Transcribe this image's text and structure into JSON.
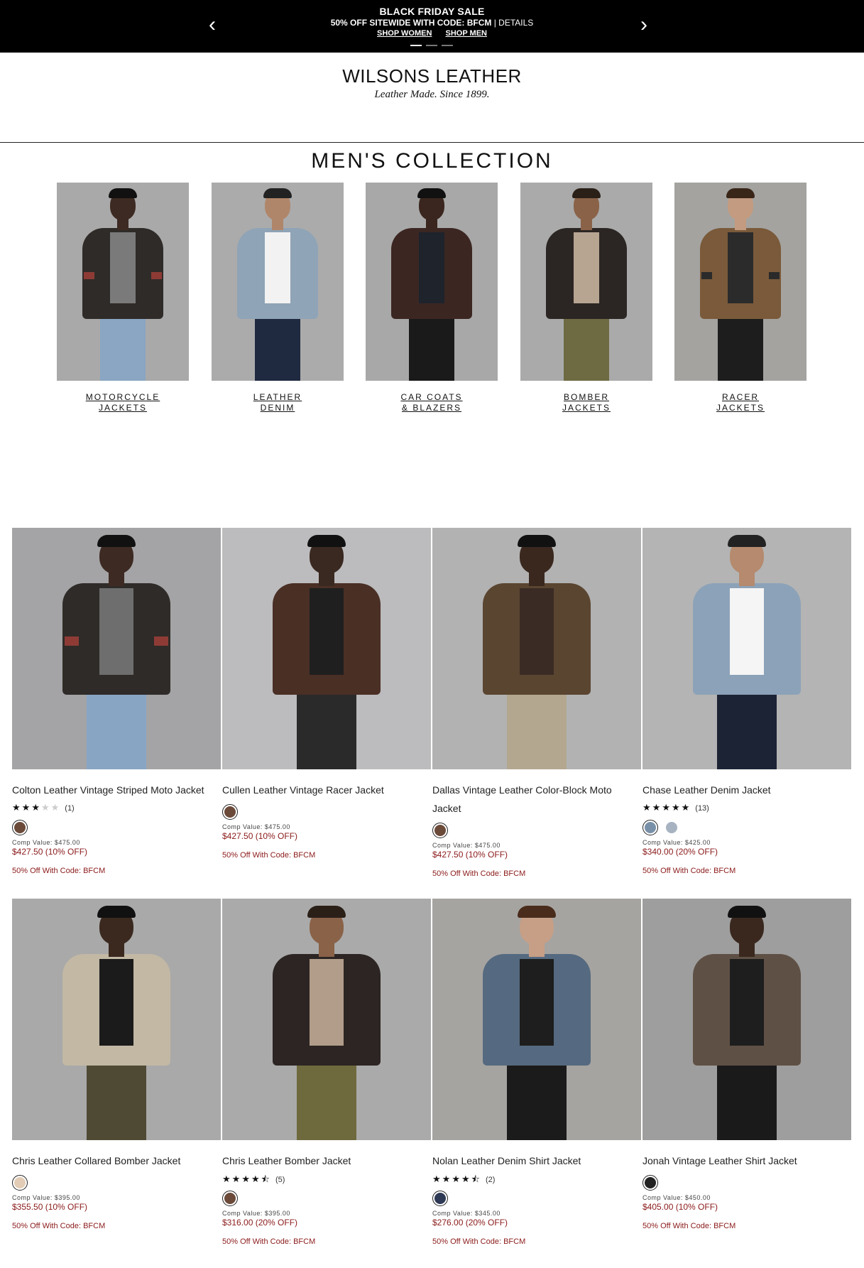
{
  "promo": {
    "title": "BLACK FRIDAY SALE",
    "line": "50% OFF SITEWIDE WITH CODE: BFCM",
    "separator": "|",
    "details": "DETAILS",
    "shop_women": "SHOP WOMEN",
    "shop_men": "SHOP MEN",
    "prev": "‹",
    "next": "›"
  },
  "logo": {
    "brand": "WILSONS LEATHER",
    "tagline": "Leather Made. Since 1899."
  },
  "collection_title": "MEN'S COLLECTION",
  "categories": [
    {
      "line1": "MOTORCYCLE",
      "line2": "JACKETS"
    },
    {
      "line1": "LEATHER",
      "line2": "DENIM"
    },
    {
      "line1": "CAR COATS",
      "line2": "& BLAZERS"
    },
    {
      "line1": "BOMBER",
      "line2": "JACKETS"
    },
    {
      "line1": "RACER",
      "line2": "JACKETS"
    }
  ],
  "products": [
    {
      "name": "Colton Leather Vintage Striped Moto Jacket",
      "rating": 3,
      "reviews": "(1)",
      "swatches": [
        "#6b4a3a"
      ],
      "comp": "Comp Value: $475.00",
      "price": "$427.50 (10% OFF)",
      "code": "50% Off With Code: BFCM"
    },
    {
      "name": "Cullen Leather Vintage Racer Jacket",
      "rating": 0,
      "reviews": "",
      "swatches": [
        "#6b4a3a"
      ],
      "comp": "Comp Value: $475.00",
      "price": "$427.50 (10% OFF)",
      "code": "50% Off With Code: BFCM"
    },
    {
      "name": "Dallas Vintage Leather Color-Block Moto Jacket",
      "rating": 0,
      "reviews": "",
      "swatches": [
        "#6b4a3a"
      ],
      "comp": "Comp Value: $475.00",
      "price": "$427.50 (10% OFF)",
      "code": "50% Off With Code: BFCM"
    },
    {
      "name": "Chase Leather Denim Jacket",
      "rating": 5,
      "reviews": "(13)",
      "swatches": [
        "#7891a8",
        "#a8b3c1"
      ],
      "comp": "Comp Value: $425.00",
      "price": "$340.00 (20% OFF)",
      "code": "50% Off With Code: BFCM"
    },
    {
      "name": "Chris Leather Collared Bomber Jacket",
      "rating": 0,
      "reviews": "",
      "swatches": [
        "#e2ccb5"
      ],
      "comp": "Comp Value: $395.00",
      "price": "$355.50 (10% OFF)",
      "code": "50% Off With Code: BFCM"
    },
    {
      "name": "Chris Leather Bomber Jacket",
      "rating": 4.5,
      "reviews": "(5)",
      "swatches": [
        "#6b4a3a"
      ],
      "comp": "Comp Value: $395.00",
      "price": "$316.00 (20% OFF)",
      "code": "50% Off With Code: BFCM"
    },
    {
      "name": "Nolan Leather Denim Shirt Jacket",
      "rating": 4.5,
      "reviews": "(2)",
      "swatches": [
        "#2e3a55"
      ],
      "comp": "Comp Value: $345.00",
      "price": "$276.00 (20% OFF)",
      "code": "50% Off With Code: BFCM"
    },
    {
      "name": "Jonah Vintage Leather Shirt Jacket",
      "rating": 0,
      "reviews": "",
      "swatches": [
        "#222222"
      ],
      "comp": "Comp Value: $450.00",
      "price": "$405.00 (10% OFF)",
      "code": "50% Off With Code: BFCM"
    }
  ],
  "colors": {
    "price_red": "#8b1a1a",
    "promo_bg": "#000000"
  }
}
